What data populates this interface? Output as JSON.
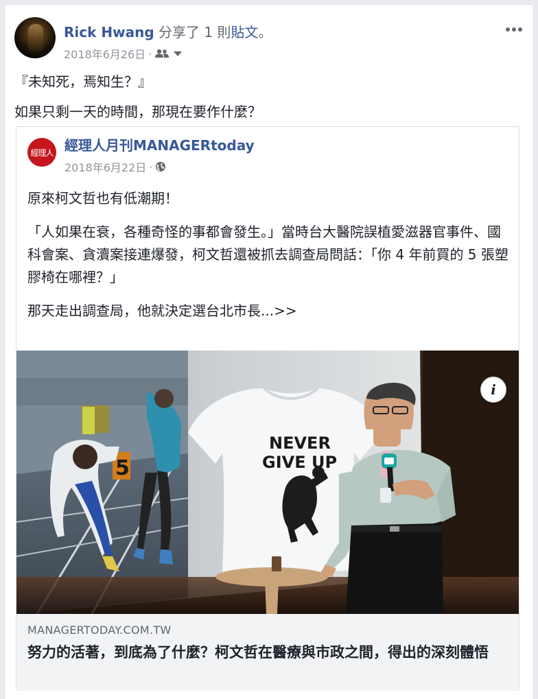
{
  "post": {
    "author": "Rick Hwang",
    "action_prefix": " 分享了 1 則",
    "action_link": "貼文",
    "action_suffix": "。",
    "date": "2018年6月26日",
    "meta_separator": "·",
    "audience_icon": "friends-icon",
    "text_lines": [
      "『未知死，焉知生？』",
      "如果只剩一天的時間，那現在要作什麼？"
    ]
  },
  "shared": {
    "logo_text": "經理人",
    "page_name": "經理人月刊MANAGERtoday",
    "date": "2018年6月22日",
    "meta_separator": "·",
    "audience_icon": "globe-icon",
    "paragraphs": [
      "原來柯文哲也有低潮期！",
      "「人如果在衰，各種奇怪的事都會發生。」當時台大醫院誤植愛滋器官事件、國科會案、貪瀆案接連爆發，柯文哲還被抓去調查局問話：「你 4 年前買的 5 張塑膠椅在哪裡？」",
      "那天走出調查局，他就決定選台北市長...>>"
    ],
    "image": {
      "shirt_text_1": "NEVER",
      "shirt_text_2": "GIVE UP",
      "lane_number": "5"
    },
    "link": {
      "domain": "MANAGERTODAY.COM.TW",
      "title": "努力的活著，到底為了什麼？柯文哲在醫療與市政之間，得出的深刻體悟"
    }
  },
  "colors": {
    "link_blue": "#385898",
    "meta_gray": "#90949c",
    "text": "#1d2129",
    "logo_red": "#c4161c"
  }
}
